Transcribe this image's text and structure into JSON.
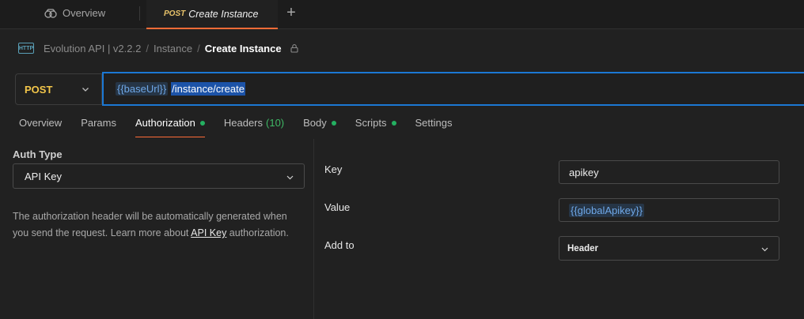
{
  "tabs": {
    "overview_label": "Overview",
    "active": {
      "method": "POST",
      "name": "Create Instance"
    },
    "new_tab_symbol": "+"
  },
  "breadcrumb": {
    "icon_text": "HTTP",
    "collection": "Evolution API | v2.2.2",
    "folder": "Instance",
    "current": "Create Instance"
  },
  "request": {
    "method": "POST",
    "url_variable": "{{baseUrl}}",
    "url_path": "/instance/create"
  },
  "request_tabs": {
    "overview": "Overview",
    "params": "Params",
    "authorization": "Authorization",
    "headers": "Headers",
    "headers_count": "(10)",
    "body": "Body",
    "scripts": "Scripts",
    "settings": "Settings"
  },
  "auth": {
    "type_label": "Auth Type",
    "type_value": "API Key",
    "description_pre": "The authorization header will be automatically generated when you send the request. Learn more about ",
    "description_link": "API Key",
    "description_post": " authorization."
  },
  "api_key": {
    "key_label": "Key",
    "key_value": "apikey",
    "value_label": "Value",
    "value_value": "{{globalApikey}}",
    "add_to_label": "Add to",
    "add_to_value": "Header"
  },
  "colors": {
    "accent": "#ff6c37",
    "focus_border": "#1b78d4",
    "method_post": "#f3c64a",
    "status_dot": "#24b061"
  }
}
